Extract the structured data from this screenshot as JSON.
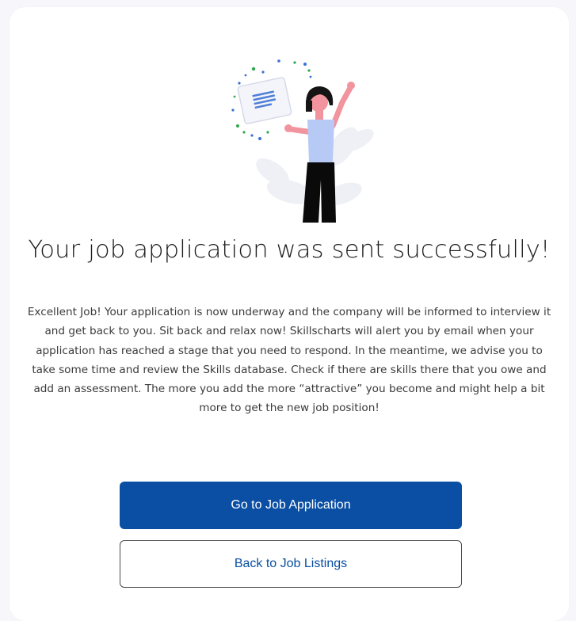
{
  "confirmation": {
    "title": "Your job application was sent successfully!",
    "message": "Excellent Job! Your application is now underway and the company will be informed to interview it and get back to you. Sit back and relax now! Skillscharts will alert you by email when your application has reached a stage that you need to respond. In the meantime, we advise you to take some time and review the Skills database. Check if there are skills there that you owe and add an assessment. The more you add the more “attractive” you become and might help a bit more to get the new job position!",
    "illustration_icon": "celebrating-woman-with-document-icon"
  },
  "actions": {
    "primary_label": "Go to Job Application",
    "secondary_label": "Back to Job Listings"
  },
  "colors": {
    "accent": "#0a4fa3",
    "background": "#f7f7fb",
    "card": "#ffffff"
  }
}
